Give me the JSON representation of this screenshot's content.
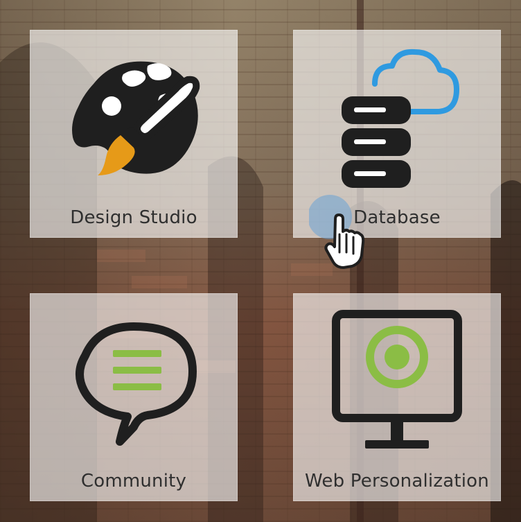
{
  "tiles": [
    {
      "label": "Design Studio"
    },
    {
      "label": "Database"
    },
    {
      "label": "Community"
    },
    {
      "label": "Web Personalization"
    }
  ],
  "icons": {
    "tile_1": "palette-brush-icon",
    "tile_2": "database-cloud-icon",
    "tile_3": "chat-bubble-icon",
    "tile_4": "monitor-target-icon",
    "cursor": "hand-cursor-icon"
  },
  "colors": {
    "dark": "#1f1f1f",
    "accent_blue": "#2f9ae0",
    "accent_green": "#8bbd45",
    "accent_orange": "#e69a18"
  }
}
